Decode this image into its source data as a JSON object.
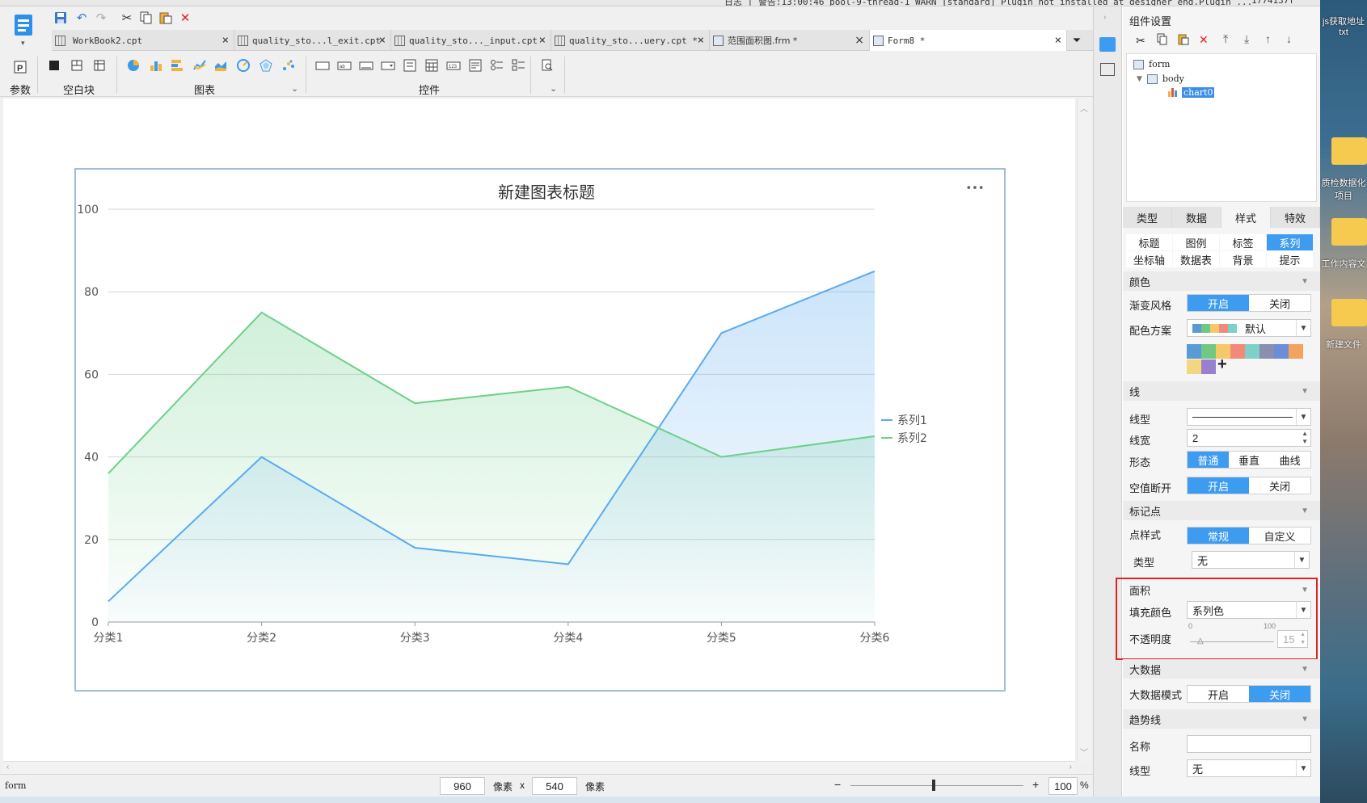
{
  "window": {
    "log_line": "日志 | 警告:13:00:46 pool-9-thread-1 WARN [standard] Plugin not installed at designer end.Plugin ...",
    "log_right": "1774137f"
  },
  "quick_access": {
    "save_icon": "save-icon",
    "undo_icon": "undo-icon",
    "redo_icon": "redo-icon",
    "cut_icon": "cut-icon",
    "copy_icon": "copy-icon",
    "paste_icon": "paste-icon",
    "delete_icon": "delete-icon"
  },
  "tabs": [
    {
      "label": "WorkBook2.cpt"
    },
    {
      "label": "quality_sto...l_exit.cpt"
    },
    {
      "label": "quality_sto..._input.cpt"
    },
    {
      "label": "quality_sto...uery.cpt *"
    },
    {
      "label": "范围面积图.frm *"
    },
    {
      "label": "Form8 *"
    }
  ],
  "ribbon": {
    "groups": [
      {
        "label": "参数"
      },
      {
        "label": "空白块"
      },
      {
        "label": "图表"
      },
      {
        "label": "控件"
      }
    ]
  },
  "chart_data": {
    "type": "area",
    "title": "新建图表标题",
    "categories": [
      "分类1",
      "分类2",
      "分类3",
      "分类4",
      "分类5",
      "分类6"
    ],
    "series": [
      {
        "name": "系列1",
        "values": [
          5,
          40,
          18,
          14,
          70,
          85
        ],
        "color": "#5aaaf0"
      },
      {
        "name": "系列2",
        "values": [
          36,
          75,
          53,
          57,
          40,
          45
        ],
        "color": "#6dd08a"
      }
    ],
    "ylim": [
      0,
      100
    ],
    "yticks": [
      0,
      20,
      40,
      60,
      80,
      100
    ],
    "grid": true,
    "legend": "right",
    "menu_glyph": "•••"
  },
  "status": {
    "component": "form",
    "width": "960",
    "width_unit": "像素",
    "times": "x",
    "height": "540",
    "height_unit": "像素",
    "zoom": "100",
    "zoom_unit": "%",
    "minus": "−",
    "plus": "+"
  },
  "panel": {
    "title": "组件设置",
    "tree": {
      "root": "form",
      "body": "body",
      "chart": "chart0"
    },
    "tabs": [
      "类型",
      "数据",
      "样式",
      "特效"
    ],
    "subtabs": [
      "标题",
      "图例",
      "标签",
      "系列",
      "坐标轴",
      "数据表",
      "背景",
      "提示"
    ],
    "color_section": {
      "head": "颜色",
      "gradient_label": "渐变风格",
      "gradient_on": "开启",
      "gradient_off": "关闭",
      "scheme_label": "配色方案",
      "scheme_value": "默认",
      "swatches": [
        "#5b9bd5",
        "#70c982",
        "#f5c86a",
        "#f28a7a",
        "#7fd0c9",
        "#8a8fb0",
        "#6a8fd8",
        "#f3a35e",
        "#f2d680",
        "#9a7fd1"
      ],
      "add": "+"
    },
    "line_section": {
      "head": "线",
      "type_label": "线型",
      "width_label": "线宽",
      "width_value": "2",
      "shape_label": "形态",
      "shape_opts": [
        "普通",
        "垂直",
        "曲线"
      ],
      "null_label": "空值断开",
      "null_on": "开启",
      "null_off": "关闭"
    },
    "marker_section": {
      "head": "标记点",
      "style_label": "点样式",
      "style_normal": "常规",
      "style_custom": "自定义",
      "type_label": "类型",
      "type_value": "无"
    },
    "area_section": {
      "head": "面积",
      "fill_label": "填充颜色",
      "fill_value": "系列色",
      "opacity_label": "不透明度",
      "min": "0",
      "max": "100",
      "value": "15",
      "opacity_level": 0.15
    },
    "bigdata_section": {
      "head": "大数据",
      "mode_label": "大数据模式",
      "mode_on": "开启",
      "mode_off": "关闭"
    },
    "trend_section": {
      "head": "趋势线",
      "name_label": "名称",
      "line_label": "线型",
      "line_value": "无"
    }
  },
  "desktop": {
    "items": [
      {
        "label": "js获取地址txt"
      },
      {
        "label": "质检数据化项目"
      },
      {
        "label": "工作内容文"
      },
      {
        "label": "新建文件"
      }
    ]
  }
}
